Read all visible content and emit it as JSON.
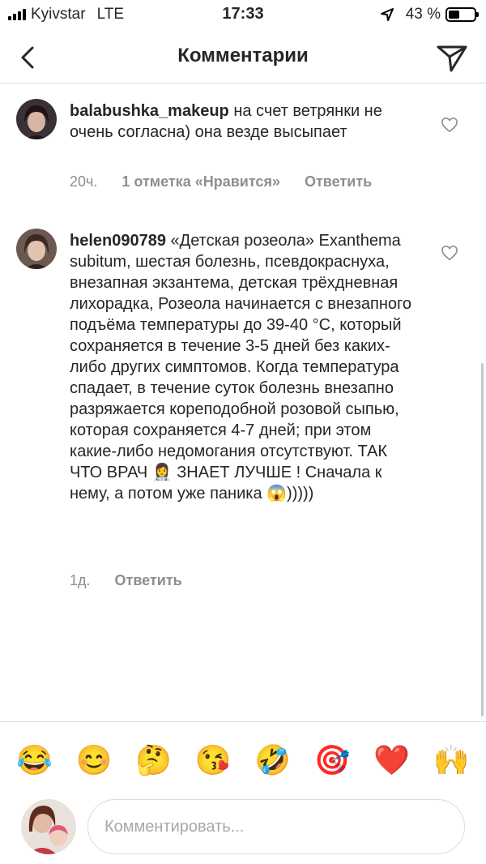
{
  "status_bar": {
    "carrier": "Kyivstar",
    "network": "LTE",
    "time": "17:33",
    "battery": "43 %",
    "battery_level": 0.43
  },
  "header": {
    "title": "Комментарии",
    "back_icon": "chevron-left-icon",
    "send_icon": "paper-plane-icon"
  },
  "comments": [
    {
      "username": "balabushka_makeup",
      "text": "на счет ветрянки не очень согласна) она везде высыпает",
      "time": "20ч.",
      "likes": "1 отметка «Нравится»",
      "reply": "Ответить"
    },
    {
      "username": "helen090789",
      "text": "«Детская розеола» Exanthema subitum, шестая болезнь, псевдокраснуха, внезапная экзантема, детская трёхдневная лихорадка, Розеола начинается с внезапного подъёма температуры до 39-40 °С, который сохраняется в течение 3-5 дней без каких-либо других симптомов. Когда температура спадает, в течение суток болезнь внезапно разряжается кореподобной розовой сыпью, которая сохраняется 4-7 дней; при этом какие-либо недомогания отсутствуют. ТАК ЧТО ВРАЧ 👩‍⚕️ ЗНАЕТ ЛУЧШЕ ! Сначала к нему, а потом уже паника 😱)))))",
      "time": "1д.",
      "reply": "Ответить"
    }
  ],
  "emoji_bar": [
    "😂",
    "😊",
    "🤔",
    "😘",
    "🤣",
    "🎯",
    "❤️",
    "🙌"
  ],
  "composer": {
    "placeholder": "Комментировать..."
  },
  "colors": {
    "text": "#262626",
    "muted": "#8e8e8e",
    "divider": "#dbdbdb"
  }
}
